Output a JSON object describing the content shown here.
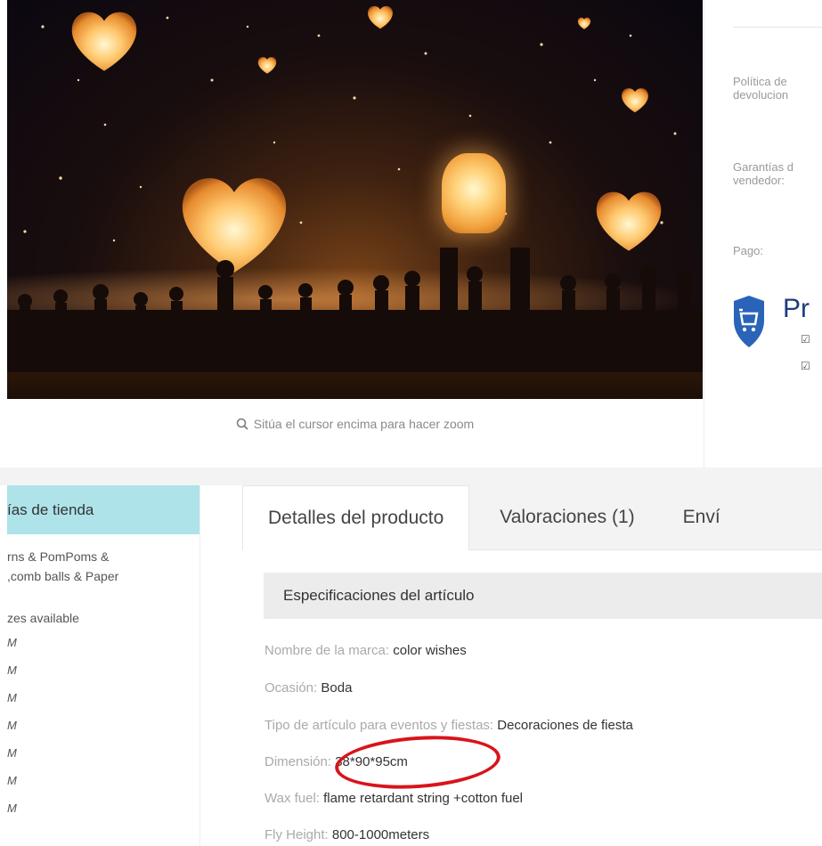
{
  "product_image": {
    "zoom_hint": "Sitúa el cursor encima para hacer zoom"
  },
  "info": {
    "return_policy_label": "Política de\ndevolucion",
    "seller_guarantee_label": "Garantías d\nvendedor:",
    "payment_label": "Pago:",
    "protection_title": "Pr"
  },
  "categories": {
    "header": "ías de tienda",
    "link": "rns & PomPoms &\n,comb balls & Paper",
    "sizes_title": "zes available",
    "sizes": [
      "M",
      "M",
      "M",
      "M",
      "M",
      "M",
      "M"
    ]
  },
  "tabs": [
    {
      "label": "Detalles del producto",
      "active": true
    },
    {
      "label": "Valoraciones (1)",
      "active": false
    },
    {
      "label": "Enví",
      "active": false
    }
  ],
  "specs": {
    "header": "Especificaciones del artículo",
    "rows": [
      {
        "label": "Nombre de la marca: ",
        "value": "color wishes"
      },
      {
        "label": "Ocasión: ",
        "value": "Boda"
      },
      {
        "label": "Tipo de artículo para eventos y fiestas: ",
        "value": "Decoraciones de fiesta"
      },
      {
        "label": "Dimensión: ",
        "value": "38*90*95cm"
      },
      {
        "label": "Wax fuel: ",
        "value": "flame retardant string +cotton fuel"
      },
      {
        "label": "Fly Height: ",
        "value": "800-1000meters"
      }
    ]
  },
  "colors": {
    "sidebar_header_bg": "#aee3ea",
    "protection_blue": "#1d3d7a",
    "annotation_red": "#d8141b"
  }
}
